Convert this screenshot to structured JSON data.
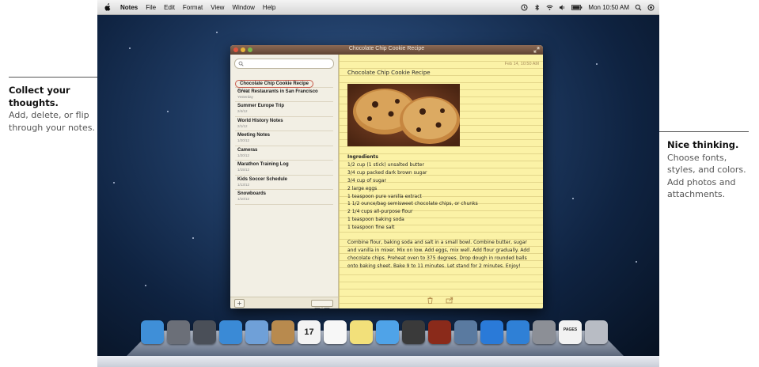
{
  "menubar": {
    "app": "Notes",
    "items": [
      "File",
      "Edit",
      "Format",
      "View",
      "Window",
      "Help"
    ],
    "clock": "Mon 10:50 AM",
    "icons": [
      "apple-icon",
      "time-machine-icon",
      "bluetooth-icon",
      "wifi-icon",
      "volume-icon",
      "battery-icon",
      "search-icon",
      "notification-icon"
    ]
  },
  "window": {
    "title": "Chocolate Chip Cookie Recipe",
    "notes": [
      {
        "title": "Chocolate Chip Cookie Recipe",
        "date": "Today",
        "selected": true
      },
      {
        "title": "Great Restaurants in San Francisco",
        "date": "Yesterday"
      },
      {
        "title": "Summer Europe Trip",
        "date": "2/4/12"
      },
      {
        "title": "World History Notes",
        "date": "2/1/12"
      },
      {
        "title": "Meeting Notes",
        "date": "1/20/12"
      },
      {
        "title": "Cameras",
        "date": "1/20/12"
      },
      {
        "title": "Marathon Training Log",
        "date": "1/15/12"
      },
      {
        "title": "Kids Soccer Schedule",
        "date": "1/13/12"
      },
      {
        "title": "Snowboards",
        "date": "1/10/12"
      }
    ],
    "add_label": "+",
    "note": {
      "date": "Feb 14, 10:50 AM",
      "title": "Chocolate Chip Cookie Recipe",
      "ingredients_heading": "Ingredients",
      "ingredients": [
        "1/2 cup (1 stick) unsalted butter",
        "3/4 cup packed dark brown sugar",
        "3/4 cup of sugar",
        "2 large eggs",
        "1 teaspoon pure vanilla extract",
        "1 1/2 ounce/bag semisweet chocolate chips, or chunks",
        "2 1/4 cups all-purpose flour",
        "1 teaspoon baking soda",
        "1 teaspoon fine salt"
      ],
      "directions": "Combine flour, baking soda and salt in a small bowl. Combine butter, sugar and vanilla in mixer. Mix on low. Add eggs, mix well. Add flour gradually. Add chocolate chips. Preheat oven to 375 degrees. Drop dough in rounded balls onto baking sheet. Bake 9 to 11 minutes. Let stand for 2 minutes. Enjoy!"
    }
  },
  "callouts": {
    "left": {
      "heading": "Collect your thoughts.",
      "body": "Add, delete, or flip through your notes."
    },
    "right": {
      "heading": "Nice thinking.",
      "body": "Choose fonts, styles, and colors. Add photos and attachments."
    }
  },
  "dock": {
    "items": [
      {
        "name": "finder",
        "color": "#3f8fd8"
      },
      {
        "name": "launchpad",
        "color": "#6b6f78"
      },
      {
        "name": "mission-control",
        "color": "#4a4f58"
      },
      {
        "name": "safari",
        "color": "#3a8ad6"
      },
      {
        "name": "mail",
        "color": "#6fa0d8"
      },
      {
        "name": "contacts",
        "color": "#b88a4e"
      },
      {
        "name": "calendar",
        "color": "#f3f3f3",
        "label": "17"
      },
      {
        "name": "reminders",
        "color": "#f7f7f7"
      },
      {
        "name": "notes",
        "color": "#f2e07a"
      },
      {
        "name": "messages",
        "color": "#4fa3e8"
      },
      {
        "name": "facetime",
        "color": "#3a3a3a"
      },
      {
        "name": "photo-booth",
        "color": "#8a2a1a"
      },
      {
        "name": "iphoto",
        "color": "#5a7aa0"
      },
      {
        "name": "itunes",
        "color": "#2a7ad8"
      },
      {
        "name": "app-store",
        "color": "#2f80d6"
      },
      {
        "name": "system-preferences",
        "color": "#8c8f96"
      },
      {
        "name": "pages-document",
        "color": "#f2f2f2",
        "label": "PAGES"
      },
      {
        "name": "trash",
        "color": "#b8bcc4"
      }
    ]
  }
}
